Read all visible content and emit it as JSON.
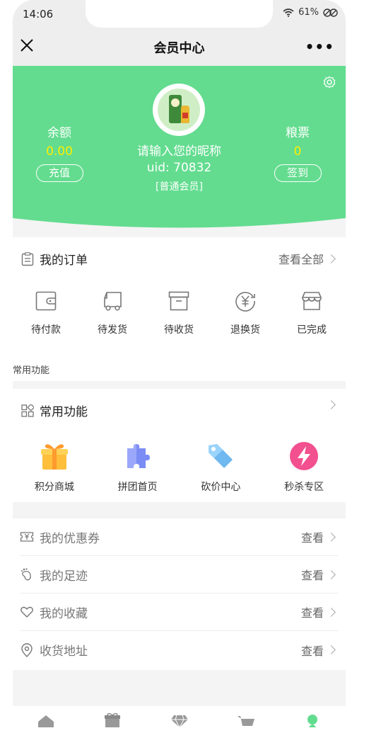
{
  "status": {
    "time": "14:06",
    "battery": "61%"
  },
  "navbar": {
    "title": "会员中心"
  },
  "hero": {
    "balance_label": "余额",
    "balance_value": "0.00",
    "recharge_button": "充值",
    "nickname": "请输入您的昵称",
    "uid": "uid: 70832",
    "level": "[普通会员]",
    "coupon_label": "粮票",
    "coupon_value": "0",
    "signin_button": "签到",
    "bg_color": "#63dc8f"
  },
  "orders": {
    "title": "我的订单",
    "view_all": "查看全部",
    "items": [
      {
        "label": "待付款",
        "icon": "wallet-icon"
      },
      {
        "label": "待发货",
        "icon": "truck-icon"
      },
      {
        "label": "待收货",
        "icon": "box-icon"
      },
      {
        "label": "退换货",
        "icon": "refund-icon"
      },
      {
        "label": "已完成",
        "icon": "store-icon"
      }
    ]
  },
  "section_caption": "常用功能",
  "features": {
    "title": "常用功能",
    "items": [
      {
        "label": "积分商城",
        "icon": "gift-icon"
      },
      {
        "label": "拼团首页",
        "icon": "puzzle-icon"
      },
      {
        "label": "砍价中心",
        "icon": "tag-icon"
      },
      {
        "label": "秒杀专区",
        "icon": "lightning-icon"
      }
    ]
  },
  "list": [
    {
      "label": "我的优惠券",
      "action": "查看",
      "icon": "coupon-icon"
    },
    {
      "label": "我的足迹",
      "action": "查看",
      "icon": "footprint-icon"
    },
    {
      "label": "我的收藏",
      "action": "查看",
      "icon": "heart-icon"
    },
    {
      "label": "收货地址",
      "action": "查看",
      "icon": "location-icon"
    }
  ]
}
